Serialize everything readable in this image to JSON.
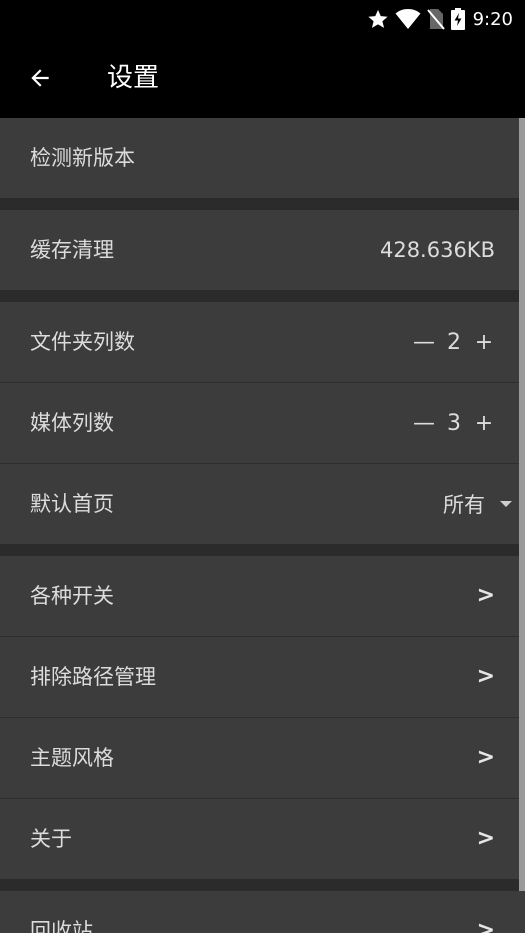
{
  "status_bar": {
    "time": "9:20"
  },
  "app_bar": {
    "title": "设置"
  },
  "sections": {
    "update": {
      "check_label": "检测新版本"
    },
    "cache": {
      "label": "缓存清理",
      "value": "428.636KB"
    },
    "layout": {
      "folder_columns": {
        "label": "文件夹列数",
        "minus": "—",
        "value": "2",
        "plus": "+"
      },
      "media_columns": {
        "label": "媒体列数",
        "minus": "—",
        "value": "3",
        "plus": "+"
      },
      "default_home": {
        "label": "默认首页",
        "value": "所有"
      }
    },
    "nav": {
      "switches": {
        "label": "各种开关",
        "arrow": ">"
      },
      "exclude_paths": {
        "label": "排除路径管理",
        "arrow": ">"
      },
      "theme": {
        "label": "主题风格",
        "arrow": ">"
      },
      "about": {
        "label": "关于",
        "arrow": ">"
      }
    },
    "trash": {
      "label": "回收站",
      "arrow": ">"
    }
  },
  "colors": {
    "background": "#2b2b2b",
    "row": "#3c3c3c",
    "bar": "#000000"
  }
}
